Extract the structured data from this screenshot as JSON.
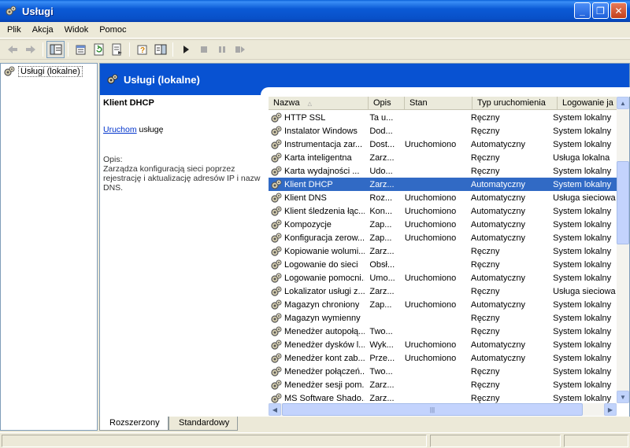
{
  "window": {
    "title": "Usługi"
  },
  "menu": [
    "Plik",
    "Akcja",
    "Widok",
    "Pomoc"
  ],
  "tree": {
    "root_label": "Usługi (lokalne)"
  },
  "pane_header": {
    "title": "Usługi (lokalne)"
  },
  "description": {
    "service_name": "Klient DHCP",
    "start_link": "Uruchom",
    "start_suffix": " usługę",
    "opis_label": "Opis:",
    "opis_text": "Zarządza konfiguracją sieci poprzez rejestrację i aktualizację adresów IP i nazw DNS."
  },
  "columns": [
    "Nazwa",
    "Opis",
    "Stan",
    "Typ uruchomienia",
    "Logowanie ja"
  ],
  "rows": [
    {
      "name": "HTTP SSL",
      "desc": "Ta u...",
      "state": "",
      "startup": "Ręczny",
      "logon": "System lokalny"
    },
    {
      "name": "Instalator Windows",
      "desc": "Dod...",
      "state": "",
      "startup": "Ręczny",
      "logon": "System lokalny"
    },
    {
      "name": "Instrumentacja zar...",
      "desc": "Dost...",
      "state": "Uruchomiono",
      "startup": "Automatyczny",
      "logon": "System lokalny"
    },
    {
      "name": "Karta inteligentna",
      "desc": "Zarz...",
      "state": "",
      "startup": "Ręczny",
      "logon": "Usługa lokalna"
    },
    {
      "name": "Karta wydajności ...",
      "desc": "Udo...",
      "state": "",
      "startup": "Ręczny",
      "logon": "System lokalny"
    },
    {
      "name": "Klient DHCP",
      "desc": "Zarz...",
      "state": "",
      "startup": "Automatyczny",
      "logon": "System lokalny",
      "selected": true
    },
    {
      "name": "Klient DNS",
      "desc": "Roz...",
      "state": "Uruchomiono",
      "startup": "Automatyczny",
      "logon": "Usługa sieciowa"
    },
    {
      "name": "Klient śledzenia łąc...",
      "desc": "Kon...",
      "state": "Uruchomiono",
      "startup": "Automatyczny",
      "logon": "System lokalny"
    },
    {
      "name": "Kompozycje",
      "desc": "Zap...",
      "state": "Uruchomiono",
      "startup": "Automatyczny",
      "logon": "System lokalny"
    },
    {
      "name": "Konfiguracja zerow...",
      "desc": "Zap...",
      "state": "Uruchomiono",
      "startup": "Automatyczny",
      "logon": "System lokalny"
    },
    {
      "name": "Kopiowanie wolumi...",
      "desc": "Zarz...",
      "state": "",
      "startup": "Ręczny",
      "logon": "System lokalny"
    },
    {
      "name": "Logowanie do sieci",
      "desc": "Obsł...",
      "state": "",
      "startup": "Ręczny",
      "logon": "System lokalny"
    },
    {
      "name": "Logowanie pomocni...",
      "desc": "Umo...",
      "state": "Uruchomiono",
      "startup": "Automatyczny",
      "logon": "System lokalny"
    },
    {
      "name": "Lokalizator usługi z...",
      "desc": "Zarz...",
      "state": "",
      "startup": "Ręczny",
      "logon": "Usługa sieciowa"
    },
    {
      "name": "Magazyn chroniony",
      "desc": "Zap...",
      "state": "Uruchomiono",
      "startup": "Automatyczny",
      "logon": "System lokalny"
    },
    {
      "name": "Magazyn wymienny",
      "desc": "",
      "state": "",
      "startup": "Ręczny",
      "logon": "System lokalny"
    },
    {
      "name": "Menedżer autopołą...",
      "desc": "Two...",
      "state": "",
      "startup": "Ręczny",
      "logon": "System lokalny"
    },
    {
      "name": "Menedżer dysków l...",
      "desc": "Wyk...",
      "state": "Uruchomiono",
      "startup": "Automatyczny",
      "logon": "System lokalny"
    },
    {
      "name": "Menedżer kont zab...",
      "desc": "Prze...",
      "state": "Uruchomiono",
      "startup": "Automatyczny",
      "logon": "System lokalny"
    },
    {
      "name": "Menedżer połączeń...",
      "desc": "Two...",
      "state": "",
      "startup": "Ręczny",
      "logon": "System lokalny"
    },
    {
      "name": "Menedżer sesji pom...",
      "desc": "Zarz...",
      "state": "",
      "startup": "Ręczny",
      "logon": "System lokalny"
    },
    {
      "name": "MS Software Shado...",
      "desc": "Zarz...",
      "state": "",
      "startup": "Ręczny",
      "logon": "System lokalny"
    }
  ],
  "tabs": [
    "Rozszerzony",
    "Standardowy"
  ],
  "colors": {
    "title_bar": "#0b5ad6",
    "pane_header": "#0852d2",
    "selection": "#316ac5",
    "link": "#0033cc"
  }
}
